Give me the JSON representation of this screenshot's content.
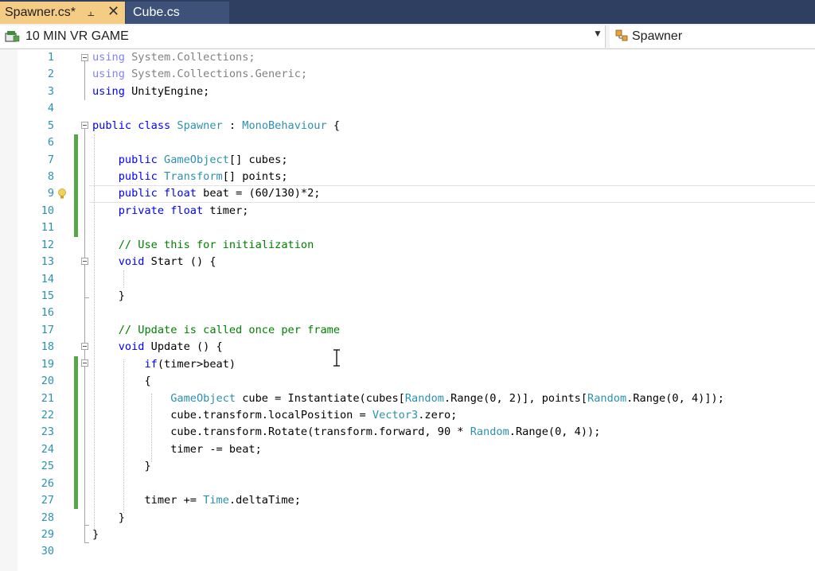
{
  "tabs": [
    {
      "label": "Spawner.cs*",
      "active": true,
      "pin_icon": "pin-icon",
      "close_icon": "close-icon"
    },
    {
      "label": "Cube.cs",
      "active": false
    }
  ],
  "navbar": {
    "project": "10 MIN VR GAME",
    "class": "Spawner",
    "project_icon": "csharp-project-icon",
    "class_icon": "class-icon"
  },
  "code": {
    "lines": [
      {
        "n": "1"
      },
      {
        "n": "2"
      },
      {
        "n": "3"
      },
      {
        "n": "4"
      },
      {
        "n": "5"
      },
      {
        "n": "6"
      },
      {
        "n": "7"
      },
      {
        "n": "8"
      },
      {
        "n": "9"
      },
      {
        "n": "10"
      },
      {
        "n": "11"
      },
      {
        "n": "12"
      },
      {
        "n": "13"
      },
      {
        "n": "14"
      },
      {
        "n": "15"
      },
      {
        "n": "16"
      },
      {
        "n": "17"
      },
      {
        "n": "18"
      },
      {
        "n": "19"
      },
      {
        "n": "20"
      },
      {
        "n": "21"
      },
      {
        "n": "22"
      },
      {
        "n": "23"
      },
      {
        "n": "24"
      },
      {
        "n": "25"
      },
      {
        "n": "26"
      },
      {
        "n": "27"
      },
      {
        "n": "28"
      },
      {
        "n": "29"
      },
      {
        "n": "30"
      }
    ],
    "tokens": {
      "l1": [
        "using",
        " System.Collections;"
      ],
      "l2": [
        "using",
        " System.Collections.Generic;"
      ],
      "l3": [
        "using",
        " UnityEngine;"
      ],
      "l5": [
        "public",
        " ",
        "class",
        " ",
        "Spawner",
        " : ",
        "MonoBehaviour",
        " {"
      ],
      "l7": [
        "    ",
        "public",
        " ",
        "GameObject",
        "[] cubes;"
      ],
      "l8": [
        "    ",
        "public",
        " ",
        "Transform",
        "[] points;"
      ],
      "l9": [
        "    ",
        "public",
        " ",
        "float",
        " beat = (60/130)*2;"
      ],
      "l10": [
        "    ",
        "private",
        " ",
        "float",
        " timer;"
      ],
      "l12": [
        "    // Use this for initialization"
      ],
      "l13": [
        "    ",
        "void",
        " Start () {"
      ],
      "l15": [
        "    }"
      ],
      "l17": [
        "    // Update is called once per frame"
      ],
      "l18": [
        "    ",
        "void",
        " Update () {"
      ],
      "l19": [
        "        ",
        "if",
        "(timer>beat)"
      ],
      "l20": [
        "        {"
      ],
      "l21": [
        "            ",
        "GameObject",
        " cube = Instantiate(cubes[",
        "Random",
        ".Range(0, 2)], points[",
        "Random",
        ".Range(0, 4)]);"
      ],
      "l22": [
        "            cube.transform.localPosition = ",
        "Vector3",
        ".zero;"
      ],
      "l23": [
        "            cube.transform.Rotate(transform.forward, 90 * ",
        "Random",
        ".Range(0, 4));"
      ],
      "l24": [
        "            timer -= beat;"
      ],
      "l25": [
        "        }"
      ],
      "l27": [
        "        timer += ",
        "Time",
        ".deltaTime;"
      ],
      "l28": [
        "    }"
      ],
      "l29": [
        "}"
      ]
    }
  },
  "icons": {
    "lightbulb": "lightbulb-icon",
    "cursor": "text-cursor-icon"
  }
}
